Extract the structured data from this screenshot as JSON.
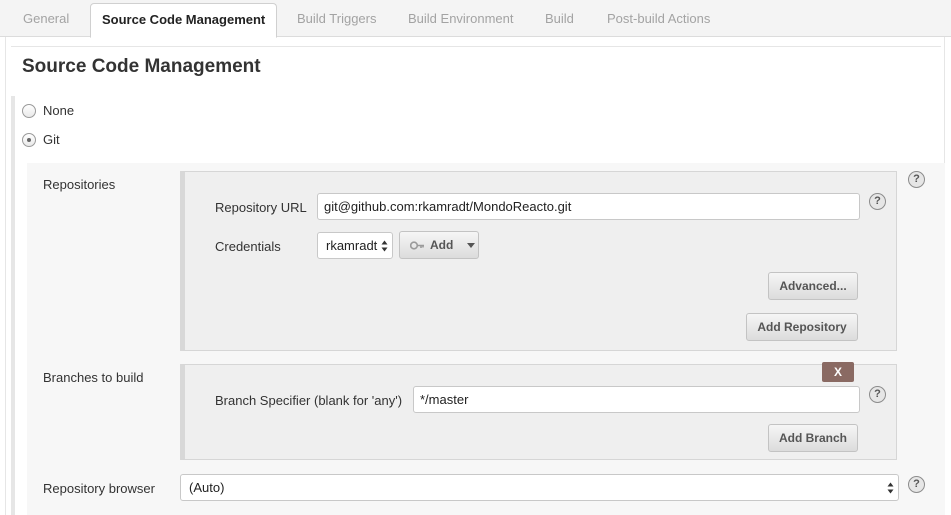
{
  "tabs": [
    {
      "label": "General",
      "active": false
    },
    {
      "label": "Source Code Management",
      "active": true
    },
    {
      "label": "Build Triggers",
      "active": false
    },
    {
      "label": "Build Environment",
      "active": false
    },
    {
      "label": "Build",
      "active": false
    },
    {
      "label": "Post-build Actions",
      "active": false
    }
  ],
  "section": {
    "title": "Source Code Management"
  },
  "scm_options": [
    {
      "label": "None",
      "selected": false
    },
    {
      "label": "Git",
      "selected": true
    }
  ],
  "repositories": {
    "label": "Repositories",
    "url_label": "Repository URL",
    "url_value": "git@github.com:rkamradt/MondoReacto.git",
    "credentials_label": "Credentials",
    "credentials_value": "rkamradt",
    "add_credentials_label": "Add",
    "advanced_label": "Advanced...",
    "add_repository_label": "Add Repository"
  },
  "branches": {
    "label": "Branches to build",
    "delete_label": "X",
    "specifier_label": "Branch Specifier (blank for 'any')",
    "specifier_value": "*/master",
    "add_branch_label": "Add Branch"
  },
  "repository_browser": {
    "label": "Repository browser",
    "value": "(Auto)"
  },
  "icons": {
    "help": "help-icon",
    "key": "key-icon",
    "dropdown": "caret-down-icon"
  }
}
